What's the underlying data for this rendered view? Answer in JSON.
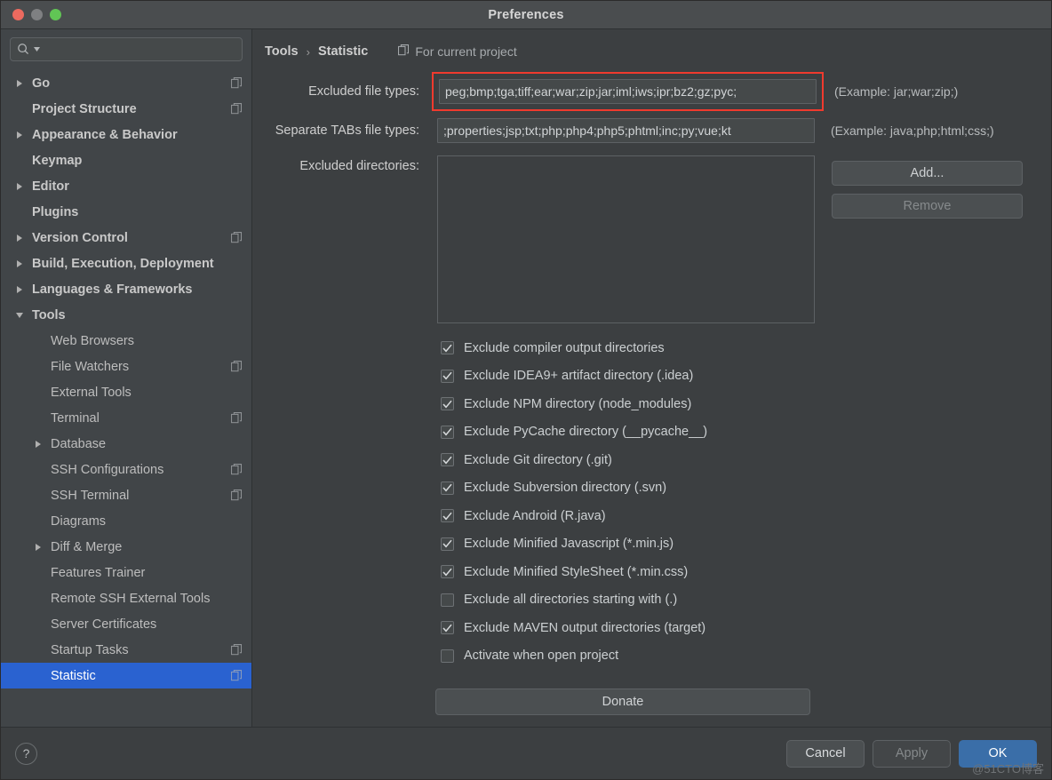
{
  "window": {
    "title": "Preferences",
    "traffic_lights": [
      "close-red",
      "minimize-gray",
      "maximize-green"
    ]
  },
  "sidebar": {
    "search": {
      "value": "",
      "placeholder": "",
      "icon": "search-icon"
    },
    "items": [
      {
        "label": "Go",
        "expandable": true,
        "expanded": false,
        "child": false,
        "bold": true,
        "copy_icon": true
      },
      {
        "label": "Project Structure",
        "expandable": false,
        "expanded": false,
        "child": false,
        "bold": true,
        "copy_icon": true
      },
      {
        "label": "Appearance & Behavior",
        "expandable": true,
        "expanded": false,
        "child": false,
        "bold": true,
        "copy_icon": false
      },
      {
        "label": "Keymap",
        "expandable": false,
        "expanded": false,
        "child": false,
        "bold": true,
        "copy_icon": false
      },
      {
        "label": "Editor",
        "expandable": true,
        "expanded": false,
        "child": false,
        "bold": true,
        "copy_icon": false
      },
      {
        "label": "Plugins",
        "expandable": false,
        "expanded": false,
        "child": false,
        "bold": true,
        "copy_icon": false
      },
      {
        "label": "Version Control",
        "expandable": true,
        "expanded": false,
        "child": false,
        "bold": true,
        "copy_icon": true
      },
      {
        "label": "Build, Execution, Deployment",
        "expandable": true,
        "expanded": false,
        "child": false,
        "bold": true,
        "copy_icon": false
      },
      {
        "label": "Languages & Frameworks",
        "expandable": true,
        "expanded": false,
        "child": false,
        "bold": true,
        "copy_icon": false
      },
      {
        "label": "Tools",
        "expandable": true,
        "expanded": true,
        "child": false,
        "bold": true,
        "copy_icon": false
      },
      {
        "label": "Web Browsers",
        "expandable": false,
        "expanded": false,
        "child": true,
        "bold": false,
        "copy_icon": false
      },
      {
        "label": "File Watchers",
        "expandable": false,
        "expanded": false,
        "child": true,
        "bold": false,
        "copy_icon": true
      },
      {
        "label": "External Tools",
        "expandable": false,
        "expanded": false,
        "child": true,
        "bold": false,
        "copy_icon": false
      },
      {
        "label": "Terminal",
        "expandable": false,
        "expanded": false,
        "child": true,
        "bold": false,
        "copy_icon": true
      },
      {
        "label": "Database",
        "expandable": true,
        "expanded": false,
        "child": true,
        "bold": false,
        "copy_icon": false
      },
      {
        "label": "SSH Configurations",
        "expandable": false,
        "expanded": false,
        "child": true,
        "bold": false,
        "copy_icon": true
      },
      {
        "label": "SSH Terminal",
        "expandable": false,
        "expanded": false,
        "child": true,
        "bold": false,
        "copy_icon": true
      },
      {
        "label": "Diagrams",
        "expandable": false,
        "expanded": false,
        "child": true,
        "bold": false,
        "copy_icon": false
      },
      {
        "label": "Diff & Merge",
        "expandable": true,
        "expanded": false,
        "child": true,
        "bold": false,
        "copy_icon": false
      },
      {
        "label": "Features Trainer",
        "expandable": false,
        "expanded": false,
        "child": true,
        "bold": false,
        "copy_icon": false
      },
      {
        "label": "Remote SSH External Tools",
        "expandable": false,
        "expanded": false,
        "child": true,
        "bold": false,
        "copy_icon": false
      },
      {
        "label": "Server Certificates",
        "expandable": false,
        "expanded": false,
        "child": true,
        "bold": false,
        "copy_icon": false
      },
      {
        "label": "Startup Tasks",
        "expandable": false,
        "expanded": false,
        "child": true,
        "bold": false,
        "copy_icon": true
      },
      {
        "label": "Statistic",
        "expandable": false,
        "expanded": false,
        "child": true,
        "bold": false,
        "copy_icon": true,
        "selected": true
      }
    ]
  },
  "main": {
    "breadcrumb": {
      "parent": "Tools",
      "separator": "›",
      "current": "Statistic"
    },
    "for_current_project": {
      "label": "For current project",
      "icon": "copy-scope-icon"
    },
    "excluded_file_types": {
      "label": "Excluded file types:",
      "value": "peg;bmp;tga;tiff;ear;war;zip;jar;iml;iws;ipr;bz2;gz;pyc;",
      "example": "(Example: jar;war;zip;)",
      "highlighted": true
    },
    "separate_tabs_file_types": {
      "label": "Separate TABs file types:",
      "value": ";properties;jsp;txt;php;php4;php5;phtml;inc;py;vue;kt",
      "example": "(Example: java;php;html;css;)"
    },
    "excluded_directories": {
      "label": "Excluded directories:",
      "value": "",
      "add_label": "Add...",
      "remove_label": "Remove",
      "remove_disabled": true
    },
    "checkboxes": [
      {
        "label": "Exclude compiler output directories",
        "checked": true
      },
      {
        "label": "Exclude IDEA9+ artifact directory (.idea)",
        "checked": true
      },
      {
        "label": "Exclude NPM directory (node_modules)",
        "checked": true
      },
      {
        "label": "Exclude PyCache directory (__pycache__)",
        "checked": true
      },
      {
        "label": "Exclude Git directory (.git)",
        "checked": true
      },
      {
        "label": "Exclude Subversion directory (.svn)",
        "checked": true
      },
      {
        "label": "Exclude Android (R.java)",
        "checked": true
      },
      {
        "label": "Exclude Minified Javascript (*.min.js)",
        "checked": true
      },
      {
        "label": "Exclude Minified StyleSheet (*.min.css)",
        "checked": true
      },
      {
        "label": "Exclude all directories starting with (.)",
        "checked": false
      },
      {
        "label": "Exclude MAVEN output directories (target)",
        "checked": true
      },
      {
        "label": "Activate when open project",
        "checked": false
      }
    ],
    "donate_label": "Donate"
  },
  "footer": {
    "help_label": "?",
    "cancel_label": "Cancel",
    "apply_label": "Apply",
    "apply_disabled": true,
    "ok_label": "OK"
  },
  "watermark": "@51CTO博客",
  "colors": {
    "selection_blue": "#2a62d0",
    "primary_button_blue": "#3a6ea8",
    "highlight_red": "#f03a2e",
    "window_bg": "#3c3f41",
    "sidebar_bg": "#414548",
    "titlebar_bg": "#4a4d4f"
  }
}
